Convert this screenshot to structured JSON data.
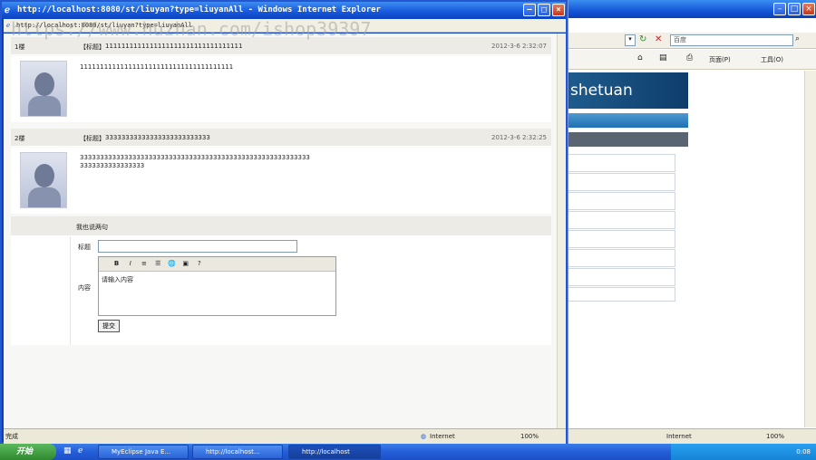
{
  "popup": {
    "title": "http://localhost:8080/st/liuyan?type=liuyanAll - Windows Internet Explorer",
    "address": "http://localhost:8080/st/liuyan?type=liuyanAll",
    "watermark": "https://www.huzhan.com/ishop39397",
    "posts": [
      {
        "floor": "1楼",
        "subject": "【标题】",
        "subject_text": "1111111111111111111111111111111111",
        "time": "2012-3-6 2:32:07",
        "body": [
          "11111111111111111111111111111111111111"
        ]
      },
      {
        "floor": "2楼",
        "subject": "【标题】",
        "subject_text": "33333333333333333333333333",
        "time": "2012-3-6 2:32:25",
        "body": [
          "333333333333333333333333333333333333333333333333333333333",
          "3333333333333333"
        ]
      }
    ],
    "form": {
      "heading": "我也说两句",
      "title_label": "标题",
      "title_value": "",
      "content_label": "内容",
      "content_text": "请输入内容",
      "submit": "提交",
      "toolbar": [
        "B",
        "I",
        "≡",
        "☰",
        "🌐",
        "▣",
        "?"
      ]
    },
    "status_left": "完成",
    "status_zone": "Internet",
    "status_zoom": "100%"
  },
  "background_window": {
    "search_placeholder": "百度",
    "page_menu": "页面(P)",
    "tools_menu": "工具(O)",
    "site_header": "shetuan",
    "status_zone": "Internet",
    "status_zoom": "100%"
  },
  "taskbar": {
    "start": "开始",
    "tasks": [
      "MyEclipse Java E...",
      "http://localhost...",
      "http://localhost"
    ],
    "clock": "0:08"
  }
}
